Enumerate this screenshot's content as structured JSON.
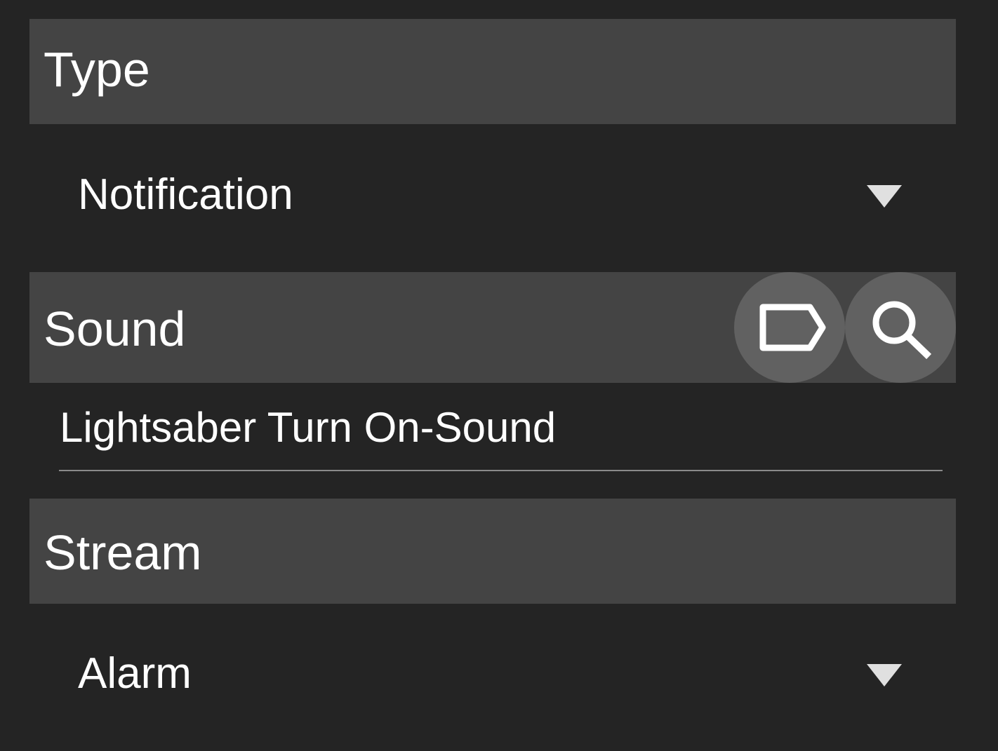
{
  "colors": {
    "background": "#242424",
    "section_header": "#444444",
    "icon_button": "#616161",
    "text": "#ffffff",
    "dropdown_arrow": "#e0e0e0",
    "field_underline": "#8a8a8a"
  },
  "type_section": {
    "header": "Type",
    "selected": "Notification",
    "arrow_icon": "dropdown-arrow-icon"
  },
  "sound_section": {
    "header": "Sound",
    "value": "Lightsaber Turn On-Sound",
    "buttons": [
      {
        "icon": "tag-icon"
      },
      {
        "icon": "search-icon"
      }
    ]
  },
  "stream_section": {
    "header": "Stream",
    "selected": "Alarm",
    "arrow_icon": "dropdown-arrow-icon"
  }
}
